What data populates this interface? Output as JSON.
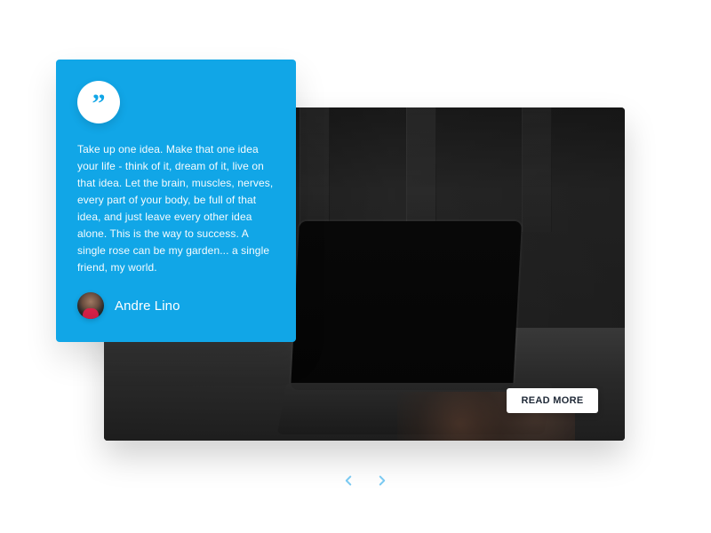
{
  "testimonial": {
    "quote_icon": "quote-icon",
    "text": "Take up one idea. Make that one idea your life - think of it, dream of it, live on that idea. Let the brain, muscles, nerves, every part of your body, be full of that idea, and just leave every other idea alone. This is the way to success. A single rose can be my garden... a single friend, my world.",
    "author": {
      "name": "Andre Lino",
      "avatar_icon": "person-icon"
    }
  },
  "hero_card": {
    "cta_label": "READ MORE"
  },
  "carousel": {
    "prev_icon": "chevron-left-icon",
    "next_icon": "chevron-right-icon"
  },
  "colors": {
    "accent": "#11A6E7",
    "white": "#FFFFFF",
    "text_dark": "#1F2937",
    "nav_arrow": "#7BC9F1"
  }
}
